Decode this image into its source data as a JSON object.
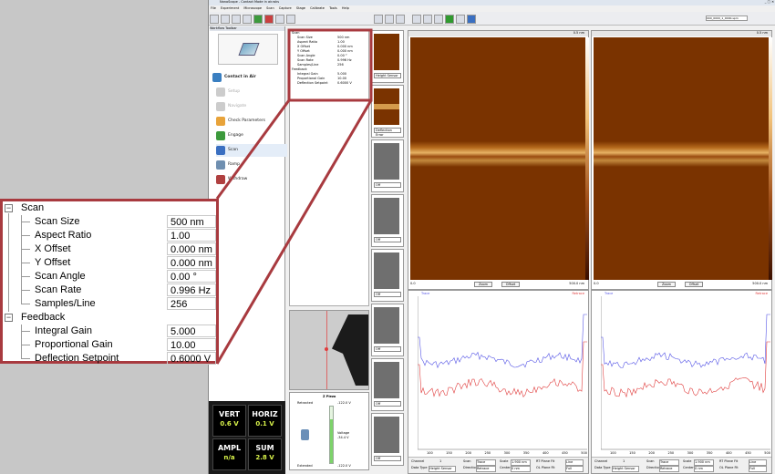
{
  "app": {
    "title": "NanoScope - Contact Mode in air.wks",
    "menu": [
      "File",
      "Experiment",
      "Microscope",
      "Scan",
      "Capture",
      "Stage",
      "Calibrate",
      "Tools",
      "Help"
    ],
    "zoom_field": "000_0000_1_0000.spm"
  },
  "workflow": {
    "title": "Workflow Toolbar",
    "mode": "Contact in Air",
    "items": [
      {
        "label": "Setup",
        "enabled": false
      },
      {
        "label": "Navigate",
        "enabled": false
      },
      {
        "label": "Check Parameters",
        "enabled": true
      },
      {
        "label": "Engage",
        "enabled": true
      },
      {
        "label": "Scan",
        "enabled": true
      },
      {
        "label": "Ramp",
        "enabled": true
      },
      {
        "label": "Withdraw",
        "enabled": true
      }
    ]
  },
  "params": {
    "scan_header": "Scan",
    "feedback_header": "Feedback",
    "scan": [
      {
        "label": "Scan Size",
        "value": "500 nm"
      },
      {
        "label": "Aspect Ratio",
        "value": "1.00"
      },
      {
        "label": "X Offset",
        "value": "0.000 nm"
      },
      {
        "label": "Y Offset",
        "value": "0.000 nm"
      },
      {
        "label": "Scan Angle",
        "value": "0.00 °"
      },
      {
        "label": "Scan Rate",
        "value": "0.996 Hz"
      },
      {
        "label": "Samples/Line",
        "value": "256"
      }
    ],
    "feedback": [
      {
        "label": "Integral Gain",
        "value": "5.000"
      },
      {
        "label": "Proportional Gain",
        "value": "10.00"
      },
      {
        "label": "Deflection Setpoint",
        "value": "0.6000 V"
      }
    ]
  },
  "meters": [
    {
      "label": "VERT",
      "value": "0.6 V"
    },
    {
      "label": "HORIZ",
      "value": "0.1 V"
    },
    {
      "label": "AMPL",
      "value": "n/a"
    },
    {
      "label": "SUM",
      "value": "2.8 V"
    }
  ],
  "zpiezo": {
    "title": "Z Piezo",
    "retracted": "Retracted",
    "extended": "Extended",
    "top_val": "-122.0 V",
    "bottom_val": "-122.0 V",
    "voltage_label": "Voltage",
    "voltage_value": "-34.4 V"
  },
  "thumbs": [
    {
      "label": "Height Sensor"
    },
    {
      "label": "Deflection Error"
    },
    {
      "label": "Off"
    },
    {
      "label": "Off"
    },
    {
      "label": "Off"
    },
    {
      "label": "Off"
    },
    {
      "label": "Off"
    },
    {
      "label": "Off"
    }
  ],
  "images": [
    {
      "zoom": "Zoom",
      "offset": "Offset",
      "scale_top": "0.5 nm",
      "scale_bottom": "500.0 nm",
      "left_val": "0.0"
    },
    {
      "zoom": "Zoom",
      "offset": "Offset",
      "scale_top": "0.5 nm",
      "scale_bottom": "500.0 nm",
      "left_val": "0.0"
    }
  ],
  "plots": [
    {
      "trace": "Trace",
      "retrace": "Retrace",
      "channel_label": "Channel",
      "channel_value": "1",
      "data_type_label": "Data Type",
      "data_type_value": "Height Sensor",
      "scan_label": "Scan",
      "scan_value": "Trace",
      "direction_label": "Direction",
      "direction_value": "Retrace",
      "scale_label": "Scale",
      "scale_value": "1.900 nm",
      "center_label": "Center",
      "center_value": "0 nm",
      "plane_fit_label": "RT Plane Fit",
      "plane_fit_value": "Line",
      "ol_plane_fit_label": "OL Plane Fit",
      "ol_plane_fit_value": "Full"
    },
    {
      "trace": "Trace",
      "retrace": "Retrace",
      "channel_label": "Channel",
      "channel_value": "1",
      "data_type_label": "Data Type",
      "data_type_value": "Height Sensor",
      "scan_label": "Scan",
      "scan_value": "Trace",
      "direction_label": "Direction",
      "direction_value": "Retrace",
      "scale_label": "Scale",
      "scale_value": "1.900 nm",
      "center_label": "Center",
      "center_value": "0 nm",
      "plane_fit_label": "RT Plane Fit",
      "plane_fit_value": "Line",
      "ol_plane_fit_label": "OL Plane Fit",
      "ol_plane_fit_value": "Full"
    }
  ],
  "x_ticks": [
    "100",
    "150",
    "200",
    "250",
    "300",
    "350",
    "400",
    "450",
    "500"
  ],
  "colors": {
    "callout": "#a83a3f",
    "afm_dark": "#7a3300",
    "meter_value": "#d8f24a",
    "trace": "#5555e6",
    "retrace": "#e03c3c"
  }
}
